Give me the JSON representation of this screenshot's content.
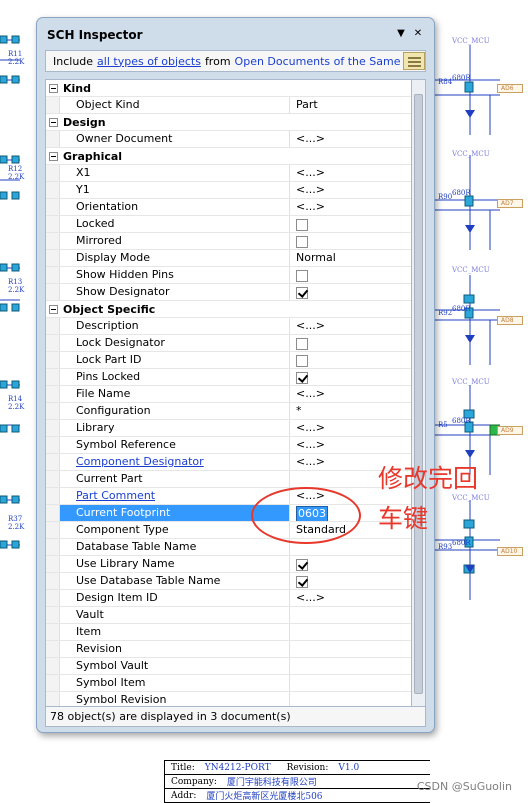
{
  "panel": {
    "title": "SCH Inspector",
    "menu_glyph": "▼",
    "close_glyph": "✕",
    "filter": {
      "include": "Include",
      "objects_link": "all types of objects",
      "from": "from",
      "scope_link": "Open Documents of the Same Project"
    },
    "status": "78 object(s) are displayed in 3 document(s)"
  },
  "sections": [
    {
      "title": "Kind",
      "rows": [
        {
          "name": "Object Kind",
          "value": "Part"
        }
      ]
    },
    {
      "title": "Design",
      "rows": [
        {
          "name": "Owner Document",
          "value": "<...>"
        }
      ]
    },
    {
      "title": "Graphical",
      "rows": [
        {
          "name": "X1",
          "value": "<...>"
        },
        {
          "name": "Y1",
          "value": "<...>"
        },
        {
          "name": "Orientation",
          "value": "<...>"
        },
        {
          "name": "Locked",
          "check": false
        },
        {
          "name": "Mirrored",
          "check": false
        },
        {
          "name": "Display Mode",
          "value": "Normal"
        },
        {
          "name": "Show Hidden Pins",
          "check": false
        },
        {
          "name": "Show Designator",
          "check": true
        }
      ]
    },
    {
      "title": "Object Specific",
      "rows": [
        {
          "name": "Description",
          "value": "<...>"
        },
        {
          "name": "Lock Designator",
          "check": false
        },
        {
          "name": "Lock Part ID",
          "check": false
        },
        {
          "name": "Pins Locked",
          "check": true
        },
        {
          "name": "File Name",
          "value": "<...>"
        },
        {
          "name": "Configuration",
          "value": "*"
        },
        {
          "name": "Library",
          "value": "<...>"
        },
        {
          "name": "Symbol Reference",
          "value": "<...>"
        },
        {
          "name": "Component Designator",
          "value": "<...>",
          "link": true
        },
        {
          "name": "Current Part",
          "value": ""
        },
        {
          "name": "Part Comment",
          "value": "<...>",
          "link": true
        },
        {
          "name": "Current Footprint",
          "value": "0603",
          "selected": true
        },
        {
          "name": "Component Type",
          "value": "Standard"
        },
        {
          "name": "Database Table Name",
          "value": ""
        },
        {
          "name": "Use Library Name",
          "check": true
        },
        {
          "name": "Use Database Table Name",
          "check": true
        },
        {
          "name": "Design Item ID",
          "value": "<...>"
        },
        {
          "name": "Vault",
          "value": ""
        },
        {
          "name": "Item",
          "value": ""
        },
        {
          "name": "Revision",
          "value": ""
        },
        {
          "name": "Symbol Vault",
          "value": ""
        },
        {
          "name": "Symbol Item",
          "value": ""
        },
        {
          "name": "Symbol Revision",
          "value": ""
        }
      ]
    }
  ],
  "annotation": {
    "line1": "修改完回",
    "line2": "车键",
    "color": "#e8382c"
  },
  "schematic": {
    "left_refs": [
      "R11",
      "R12",
      "R13",
      "R14",
      "R37"
    ],
    "left_vals": [
      "2.2K",
      "2.2K",
      "2.2K",
      "2.2K",
      "2.2K"
    ],
    "right_refs": [
      "R84",
      "R90",
      "R92",
      "R5",
      "R93"
    ],
    "right_vals": [
      "680R",
      "680R",
      "680R",
      "680R",
      "680R"
    ],
    "net": "VCC_MCU",
    "ports": [
      "AD6",
      "AD7",
      "AD8",
      "AD9",
      "AD10"
    ]
  },
  "title_block": {
    "title_key": "Title:",
    "title_val": "YN4212-PORT",
    "revision_key": "Revision:",
    "revision_val": "V1.0",
    "company_key": "Company:",
    "company_val": "厦门宇能科技有限公司",
    "addr_key": "Addr:",
    "addr_val": "厦门火炬高新区光厦楼北506"
  },
  "watermark": "CSDN @SuGuolin",
  "colors": {
    "selection": "#3399ff",
    "link": "#1a3fd0",
    "panel_bg": "#cfdcea"
  }
}
